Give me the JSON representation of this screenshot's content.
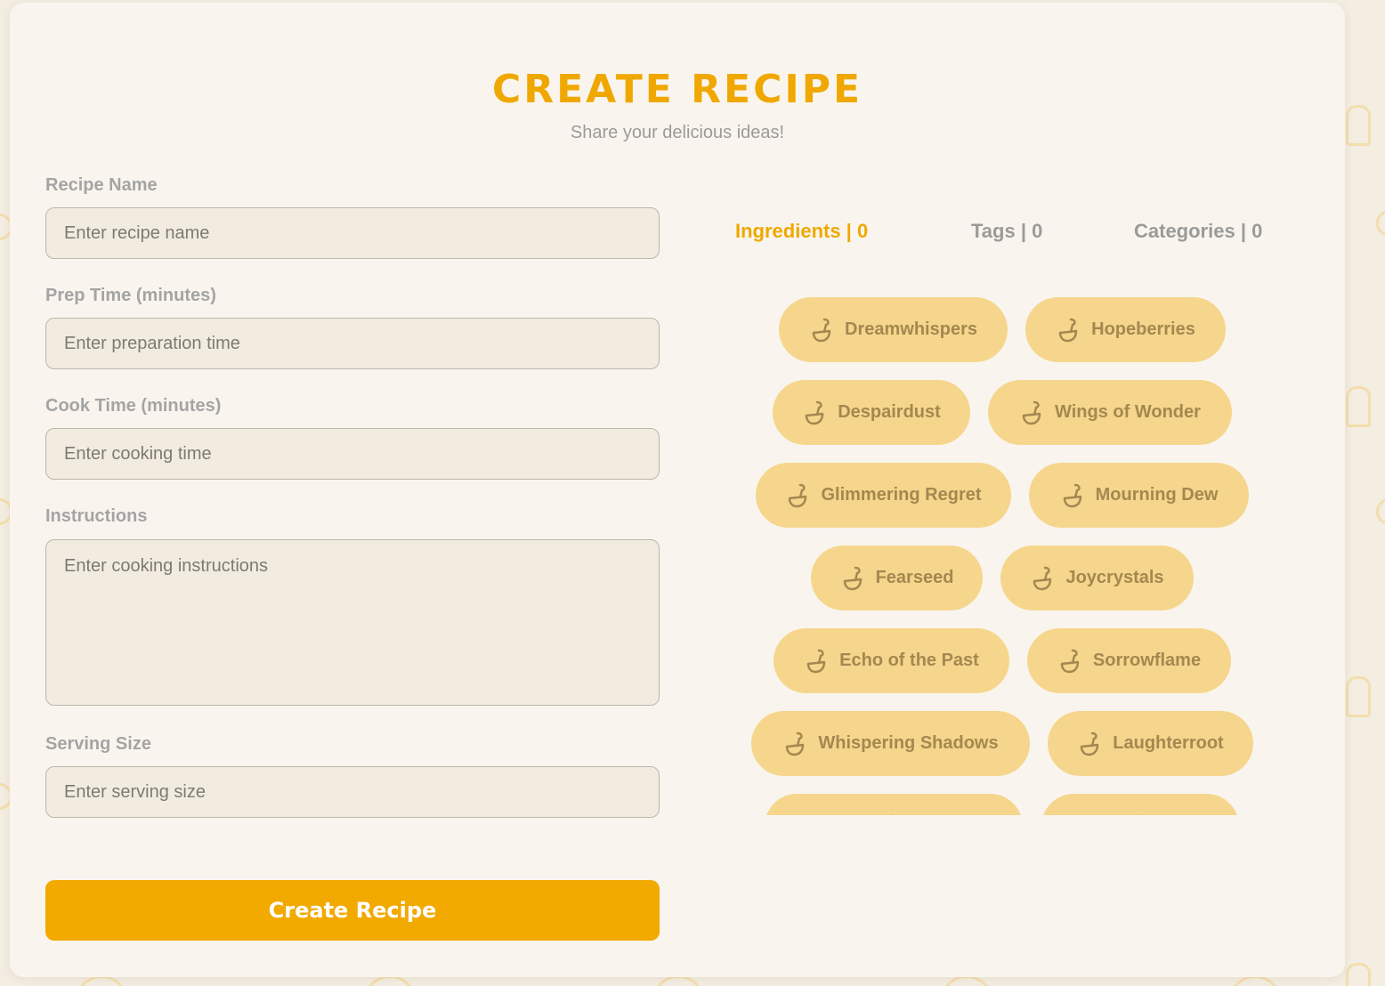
{
  "header": {
    "title": "CREATE RECIPE",
    "subtitle": "Share your delicious ideas!"
  },
  "form": {
    "recipe_name": {
      "label": "Recipe Name",
      "placeholder": "Enter recipe name",
      "value": ""
    },
    "prep_time": {
      "label": "Prep Time (minutes)",
      "placeholder": "Enter preparation time",
      "value": ""
    },
    "cook_time": {
      "label": "Cook Time (minutes)",
      "placeholder": "Enter cooking time",
      "value": ""
    },
    "instructions": {
      "label": "Instructions",
      "placeholder": "Enter cooking instructions",
      "value": ""
    },
    "serving_size": {
      "label": "Serving Size",
      "placeholder": "Enter serving size",
      "value": ""
    },
    "submit_label": "Create Recipe"
  },
  "tabs": [
    {
      "label": "Ingredients | 0",
      "active": true
    },
    {
      "label": "Tags | 0",
      "active": false
    },
    {
      "label": "Categories | 0",
      "active": false
    }
  ],
  "ingredients": [
    {
      "label": "Dreamwhispers",
      "icon": "ladle-icon"
    },
    {
      "label": "Hopeberries",
      "icon": "ladle-icon"
    },
    {
      "label": "Despairdust",
      "icon": "ladle-icon"
    },
    {
      "label": "Wings of Wonder",
      "icon": "ladle-icon"
    },
    {
      "label": "Glimmering Regret",
      "icon": "ladle-icon"
    },
    {
      "label": "Mourning Dew",
      "icon": "ladle-icon"
    },
    {
      "label": "Fearseed",
      "icon": "ladle-icon"
    },
    {
      "label": "Joycrystals",
      "icon": "ladle-icon"
    },
    {
      "label": "Echo of the Past",
      "icon": "ladle-icon"
    },
    {
      "label": "Sorrowflame",
      "icon": "ladle-icon"
    },
    {
      "label": "Whispering Shadows",
      "icon": "ladle-icon"
    },
    {
      "label": "Laughterroot",
      "icon": "ladle-icon"
    },
    {
      "label": "",
      "icon": "ladle-icon"
    },
    {
      "label": "",
      "icon": "ladle-icon"
    }
  ],
  "colors": {
    "accent": "#f0a800",
    "button": "#f2a900",
    "chip_bg": "#f5d68c",
    "chip_text": "#a48850",
    "card_bg": "#f9f5ee",
    "page_bg": "#f3ede2"
  }
}
